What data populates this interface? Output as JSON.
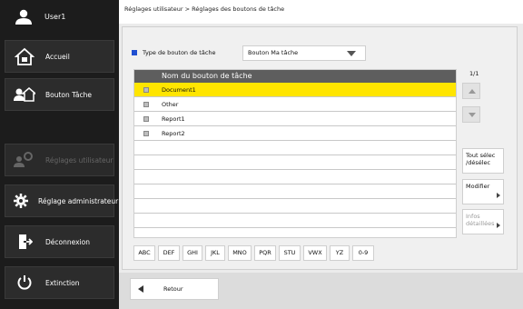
{
  "sidebar": {
    "user": "User1",
    "items": [
      {
        "label": "Accueil"
      },
      {
        "label": "Bouton Tâche"
      },
      {
        "label": "Réglages utilisateur"
      },
      {
        "label": "Réglage administrateur"
      },
      {
        "label": "Déconnexion"
      },
      {
        "label": "Extinction"
      }
    ]
  },
  "breadcrumb": "Réglages utilisateur > Réglages des boutons de tâche",
  "type_label": "Type de bouton de tâche",
  "type_select": "Bouton Ma tâche",
  "list": {
    "header": "Nom du bouton de tâche",
    "rows": [
      "Document1",
      "Other",
      "Report1",
      "Report2"
    ]
  },
  "page_indicator": "1/1",
  "side_buttons": {
    "select_all_line1": "Tout sélec",
    "select_all_line2": "/désélec",
    "modify": "Modifier",
    "details_line1": "Infos",
    "details_line2": "détaillées"
  },
  "alphabet": [
    "ABC",
    "DEF",
    "GHI",
    "JKL",
    "MNO",
    "PQR",
    "STU",
    "VWX",
    "YZ",
    "0-9"
  ],
  "back": "Retour",
  "colors": {
    "accent": "#1f4fd1",
    "selected": "#ffe500",
    "header": "#5e5e5e"
  }
}
